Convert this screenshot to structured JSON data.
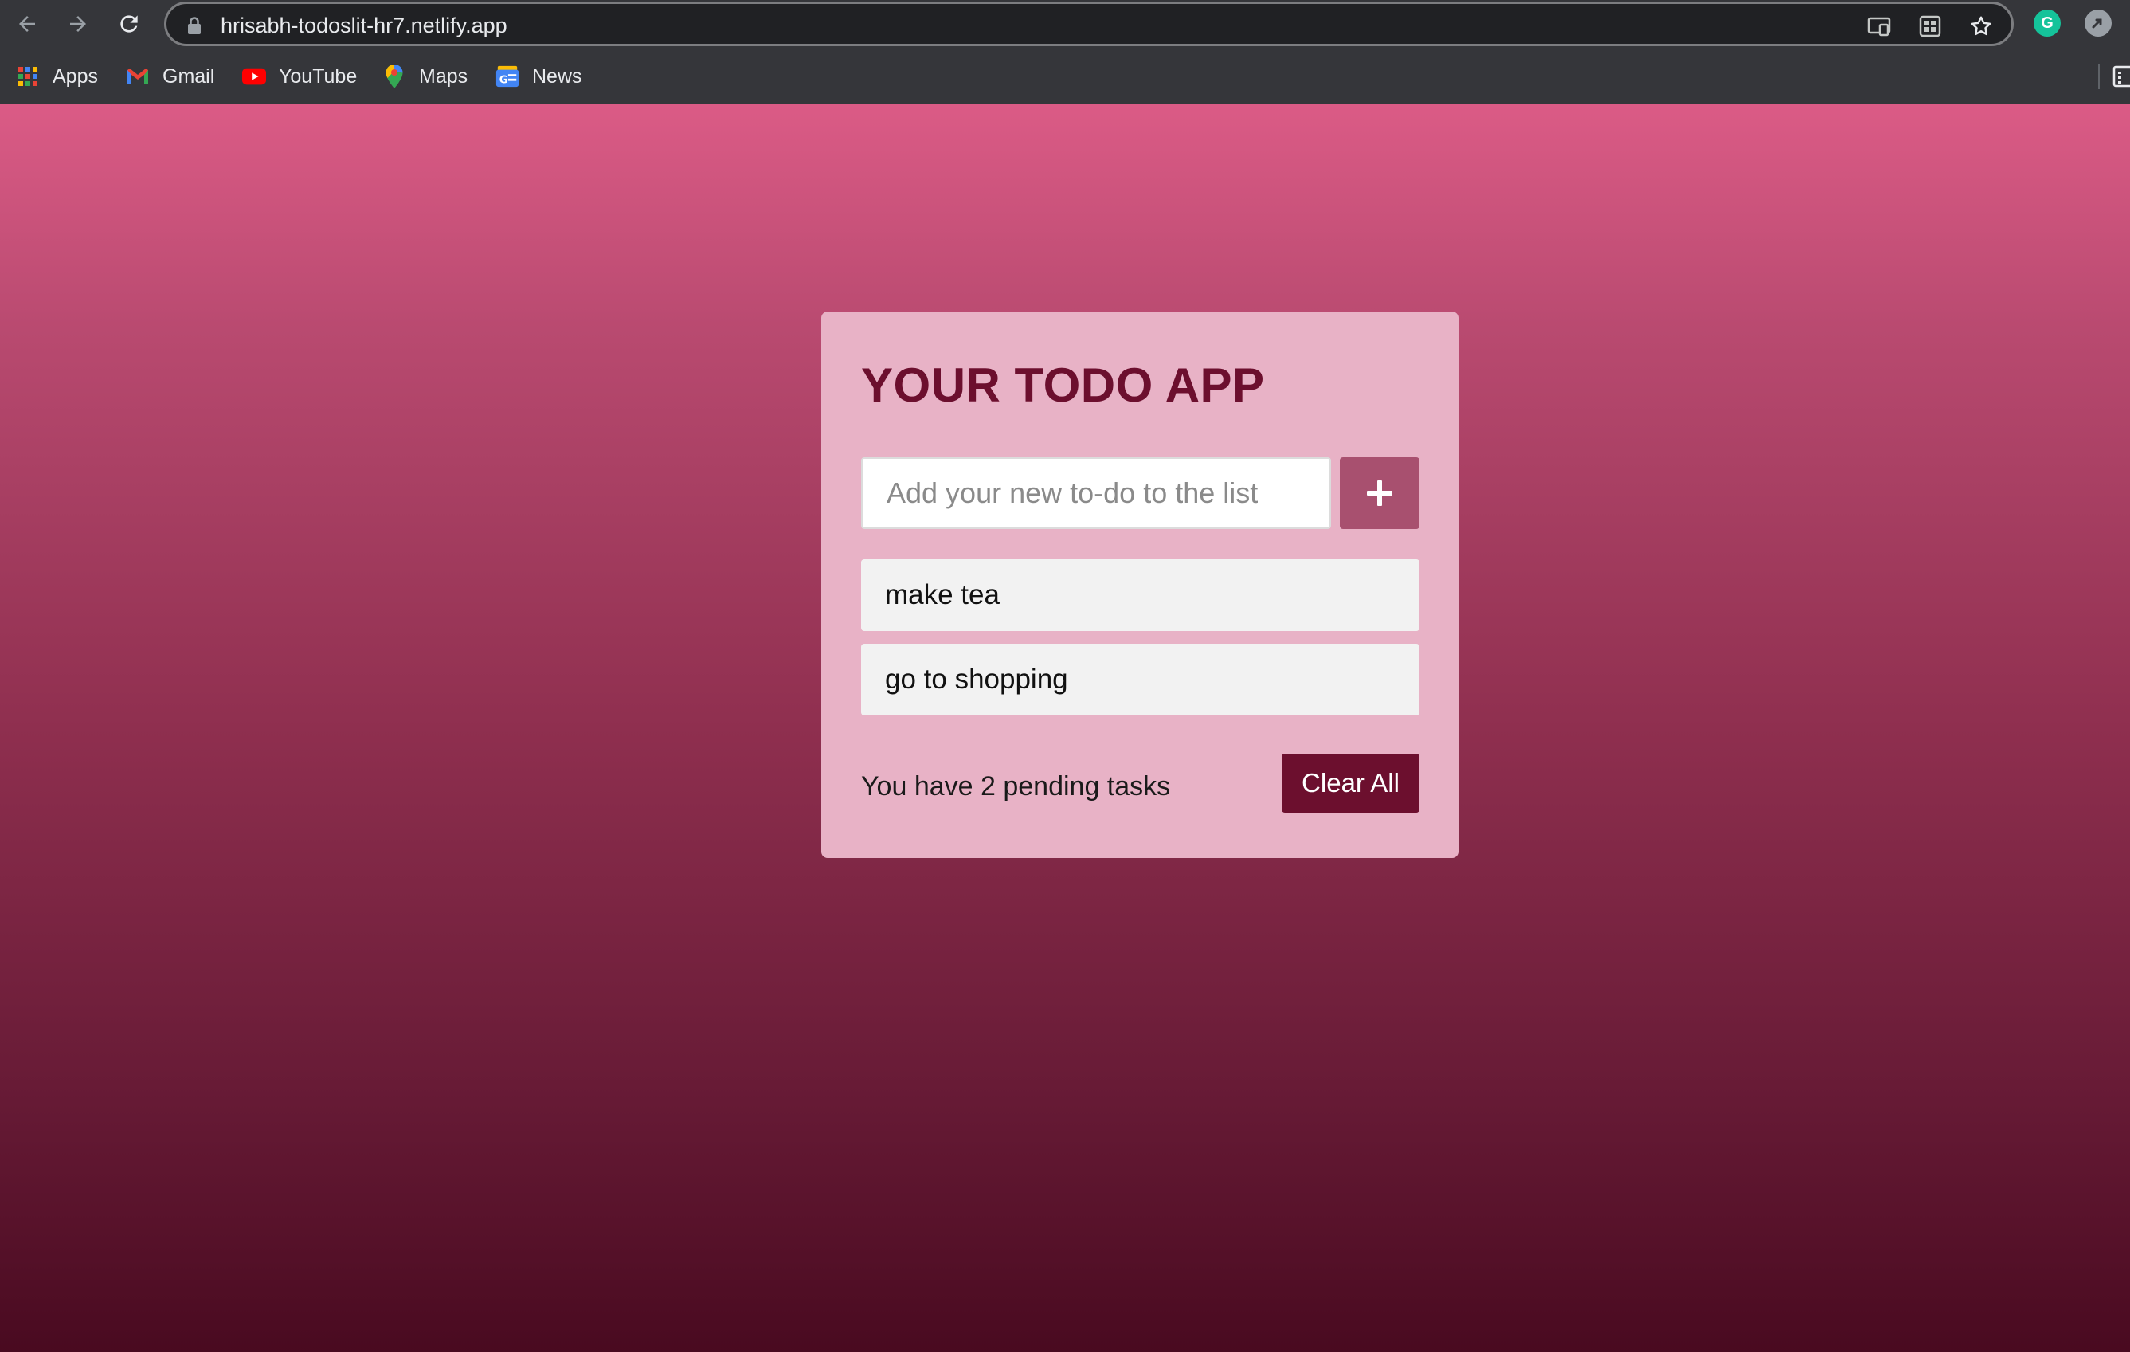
{
  "browser": {
    "url": "hrisabh-todoslit-hr7.netlify.app",
    "nav": {
      "back_icon": "back-arrow-icon",
      "forward_icon": "forward-arrow-icon",
      "reload_icon": "reload-icon"
    },
    "omnibox_icons": [
      "lock-icon",
      "cast-icon",
      "tab-search-icon",
      "star-icon"
    ],
    "extensions": [
      {
        "name": "grammarly-icon",
        "letter": "G",
        "color": "#15c39a"
      },
      {
        "name": "extension-icon",
        "letter": "",
        "color": "#9aa0a6"
      }
    ],
    "bookmarks": [
      {
        "label": "Apps",
        "icon": "apps-grid-icon"
      },
      {
        "label": "Gmail",
        "icon": "gmail-icon"
      },
      {
        "label": "YouTube",
        "icon": "youtube-icon"
      },
      {
        "label": "Maps",
        "icon": "maps-pin-icon"
      },
      {
        "label": "News",
        "icon": "news-icon"
      }
    ]
  },
  "app": {
    "title": "YOUR TODO APP",
    "input": {
      "placeholder": "Add your new to-do to the list",
      "value": ""
    },
    "add_button_icon": "plus-icon",
    "todos": [
      {
        "text": "make tea"
      },
      {
        "text": "go to shopping"
      }
    ],
    "footer": {
      "pending_text": "You have 2 pending tasks",
      "clear_label": "Clear All"
    }
  },
  "colors": {
    "gradient_top": "#db5b86",
    "gradient_bottom": "#490a20",
    "card_bg": "#e8b2c6",
    "title": "#6c0f2e",
    "add_button": "#a8506f",
    "clear_button": "#6c0f2e",
    "todo_bg": "#f2f2f2"
  }
}
